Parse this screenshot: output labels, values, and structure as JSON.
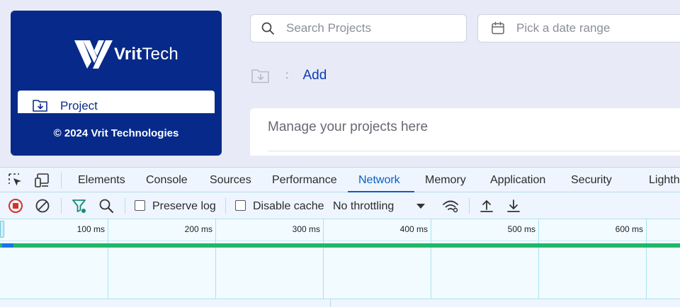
{
  "app": {
    "brand": {
      "name_bold": "Vrit",
      "name_light": "Tech"
    },
    "sidebar": {
      "items": [
        {
          "label": "Project",
          "icon": "folder-download-icon"
        }
      ],
      "copyright": "© 2024 Vrit Technologies"
    },
    "search": {
      "placeholder": "Search Projects",
      "value": ""
    },
    "date_range": {
      "placeholder": "Pick a date range",
      "value": ""
    },
    "breadcrumb": {
      "separator": ":",
      "link": "Add"
    },
    "card": {
      "subtitle": "Manage your projects here"
    }
  },
  "devtools": {
    "tabs": [
      "Elements",
      "Console",
      "Sources",
      "Performance",
      "Network",
      "Memory",
      "Application",
      "Security",
      "Lighth"
    ],
    "active_tab": "Network",
    "toolbar": {
      "preserve_log": {
        "label": "Preserve log",
        "checked": false
      },
      "disable_cache": {
        "label": "Disable cache",
        "checked": false
      },
      "throttling": "No throttling"
    },
    "timeline_ticks": [
      "100 ms",
      "200 ms",
      "300 ms",
      "400 ms",
      "500 ms",
      "600 ms"
    ],
    "colors": {
      "accent": "#0a5fbf",
      "record": "#d93025",
      "filter": "#188a7a",
      "waterfall": "#1fb86a"
    }
  }
}
